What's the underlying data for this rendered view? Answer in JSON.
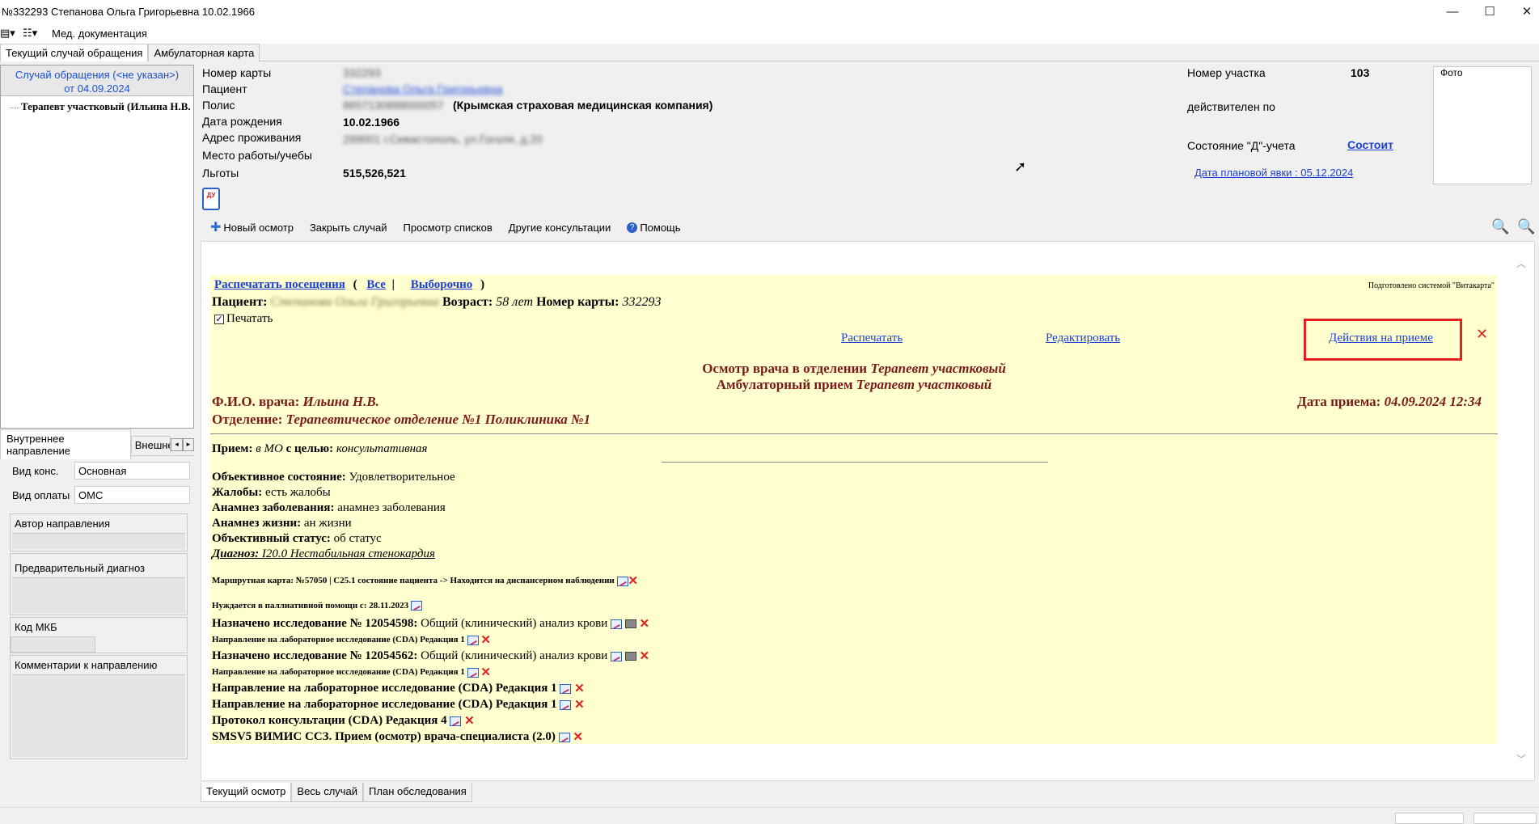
{
  "window": {
    "title": "№332293 Степанова Ольга Григорьевна 10.02.1966",
    "minimize": "—",
    "maximize": "☐",
    "close": "✕"
  },
  "menu": {
    "med_docs": "Мед. документация"
  },
  "top_tabs": [
    "Текущий случай обращения",
    "Амбулаторная карта"
  ],
  "left": {
    "case_line1": "Случай обращения (<не указан>)",
    "case_line2": "от 04.09.2024",
    "doctor": "Терапевт участковый (Ильина Н.В.",
    "tab_internal": "Внутреннее направление",
    "tab_external": "Внешне",
    "vid_kons_label": "Вид конс.",
    "vid_kons_value": "Основная",
    "vid_oplaty_label": "Вид оплаты",
    "vid_oplaty_value": "ОМС",
    "author_label": "Автор направления",
    "prelim_diag_label": "Предварительный диагноз",
    "mkb_label": "Код МКБ",
    "comments_label": "Комментарии к направлению"
  },
  "patient": {
    "card_label": "Номер карты",
    "card_value": "332293",
    "patient_label": "Пациент",
    "patient_value": "Степанова Ольга Григорьевна",
    "polis_label": "Полис",
    "polis_number": "8657130898000057",
    "polis_company": "(Крымская страховая медицинская компания)",
    "dob_label": "Дата рождения",
    "dob_value": "10.02.1966",
    "address_label": "Адрес проживания",
    "address_value": "299001 г.Севастополь, ул.Гоголя, д.20",
    "work_label": "Место работы/учебы",
    "benefits_label": "Льготы",
    "benefits_value": "515,526,521",
    "district_label": "Номер участка",
    "district_value": "103",
    "valid_label": "действителен по",
    "d_state_label": "Состояние \"Д\"-учета",
    "d_state_value": "Состоит",
    "planned_visit": "Дата плановой явки : 05.12.2024",
    "photo_label": "Фото",
    "du_icon": "ДУ"
  },
  "toolbar": {
    "new_exam": "Новый осмотр",
    "close_case": "Закрыть случай",
    "view_lists": "Просмотр списков",
    "other_consults": "Другие консультации",
    "help": "Помощь"
  },
  "doc": {
    "print_visits": "Распечатать посещения",
    "open_paren": "(",
    "all": "Все",
    "sep": "|",
    "selective": "Выборочно",
    "close_paren": ")",
    "prepared_by": "Подготовлено системой \"Витакарта\"",
    "patient_label": "Пациент:",
    "patient_name": "Степанова Ольга Григорьевна",
    "age_label": "Возраст:",
    "age_value": "58 лет",
    "card_label": "Номер карты:",
    "card_value": "332293",
    "print_check": "Печатать",
    "print_link": "Распечатать",
    "edit_link": "Редактировать",
    "actions_link": "Действия на приеме",
    "title_line1_a": "Осмотр врача в отделении",
    "title_line1_b": "Терапевт участковый",
    "title_line2_a": "Амбулаторный прием",
    "title_line2_b": "Терапевт участковый",
    "doctor_label": "Ф.И.О. врача:",
    "doctor_value": "Ильина Н.В.",
    "date_label": "Дата приема:",
    "date_value": "04.09.2024 12:34",
    "dept_label": "Отделение:",
    "dept_value": "Терапевтическое отделение №1 Поликлиника №1",
    "priem_label": "Прием:",
    "priem_place": "в МО",
    "priem_goal_label": "с целью:",
    "priem_goal": "консультативная",
    "obj_state_label": "Объективное состояние:",
    "obj_state": "Удовлетворительное",
    "complaints_label": "Жалобы:",
    "complaints": "есть жалобы",
    "anamnesis_label": "Анамнез заболевания:",
    "anamnesis": "анамнез заболевания",
    "life_label": "Анамнез жизни:",
    "life": "ан жизни",
    "status_label": "Объективный статус:",
    "status": "об статус",
    "diag_label": "Диагноз:",
    "diag": "I20.0 Нестабильная стенокардия",
    "route_card": "Маршрутная карта: №57050 | С25.1 состояние пациента -> Находится на диспансерном наблюдении",
    "palliative": "Нуждается в паллиативной помощи с: 28.11.2023",
    "study1_label": "Назначено исследование № 12054598:",
    "study1": "Общий (клинический) анализ крови",
    "lab_dir_small1": "Направление на лабораторное исследование (CDA) Редакция 1",
    "study2_label": "Назначено исследование № 12054562:",
    "study2": "Общий (клинический) анализ крови",
    "lab_dir_small2": "Направление на лабораторное исследование (CDA) Редакция 1",
    "lab_dir_big1": "Направление на лабораторное исследование (CDA) Редакция 1",
    "lab_dir_big2": "Направление на лабораторное исследование (CDA) Редакция 1",
    "protocol": "Протокол консультации (CDA) Редакция 4",
    "smsv": "SMSV5 ВИМИС ССЗ. Прием (осмотр) врача-специалиста (2.0)"
  },
  "bottom_tabs": [
    "Текущий осмотр",
    "Весь случай",
    "План обследования"
  ],
  "highlight_color": "#e02020"
}
